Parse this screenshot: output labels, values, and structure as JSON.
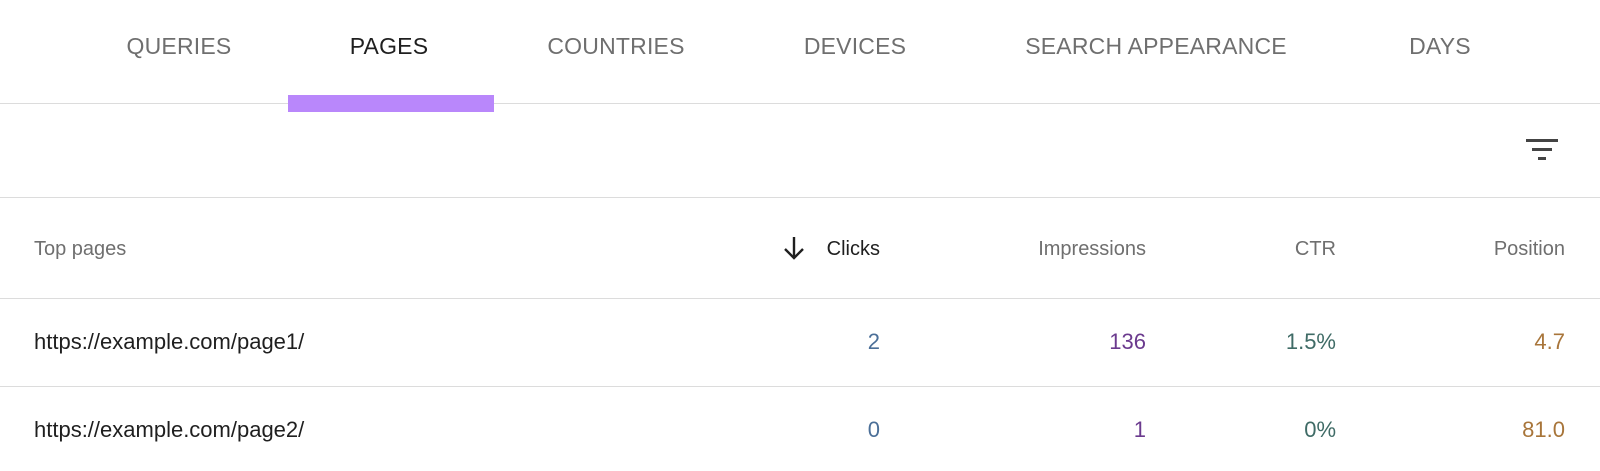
{
  "tabs": [
    {
      "label": "QUERIES",
      "active": false
    },
    {
      "label": "PAGES",
      "active": true
    },
    {
      "label": "COUNTRIES",
      "active": false
    },
    {
      "label": "DEVICES",
      "active": false
    },
    {
      "label": "SEARCH APPEARANCE",
      "active": false
    },
    {
      "label": "DAYS",
      "active": false
    }
  ],
  "toolbar": {
    "filter_icon": "filter-icon"
  },
  "table": {
    "columns": {
      "page": "Top pages",
      "clicks": "Clicks",
      "impressions": "Impressions",
      "ctr": "CTR",
      "position": "Position"
    },
    "sorted_by": "clicks",
    "sort_direction": "descending",
    "rows": [
      {
        "url": "https://example.com/page1/",
        "clicks": "2",
        "impressions": "136",
        "ctr": "1.5%",
        "position": "4.7"
      },
      {
        "url": "https://example.com/page2/",
        "clicks": "0",
        "impressions": "1",
        "ctr": "0%",
        "position": "81.0"
      }
    ]
  },
  "colors": {
    "accent_underline": "#b987fb",
    "clicks": "#4b6f98",
    "impressions": "#6b3a8e",
    "ctr": "#3f6b66",
    "position": "#a8753a"
  }
}
